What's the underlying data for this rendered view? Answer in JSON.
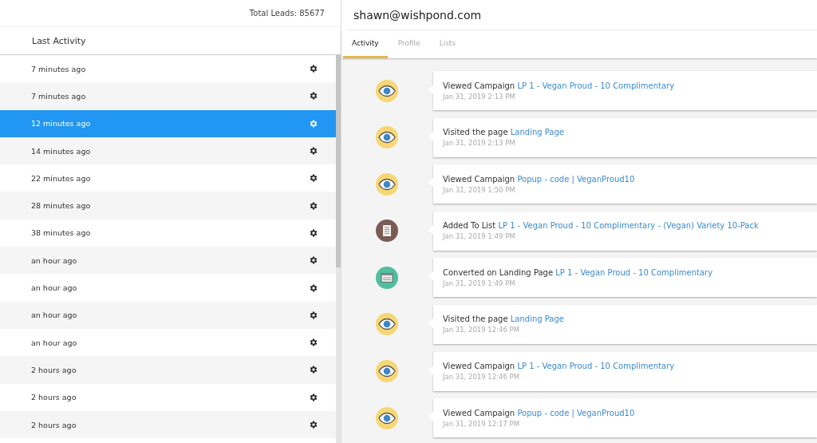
{
  "leads_panel": {
    "total": "Total Leads: 85677",
    "column_header": "Last Activity",
    "rows": [
      {
        "time": "7 minutes ago",
        "selected": false
      },
      {
        "time": "7 minutes ago",
        "selected": false
      },
      {
        "time": "12 minutes ago",
        "selected": true
      },
      {
        "time": "14 minutes ago",
        "selected": false
      },
      {
        "time": "22 minutes ago",
        "selected": false
      },
      {
        "time": "28 minutes ago",
        "selected": false
      },
      {
        "time": "38 minutes ago",
        "selected": false
      },
      {
        "time": "an hour ago",
        "selected": false
      },
      {
        "time": "an hour ago",
        "selected": false
      },
      {
        "time": "an hour ago",
        "selected": false
      },
      {
        "time": "an hour ago",
        "selected": false
      },
      {
        "time": "2 hours ago",
        "selected": false
      },
      {
        "time": "2 hours ago",
        "selected": false
      },
      {
        "time": "2 hours ago",
        "selected": false
      }
    ]
  },
  "detail": {
    "email": "shawn@wishpond.com",
    "tabs": [
      {
        "label": "Activity",
        "selected": true
      },
      {
        "label": "Profile",
        "selected": false
      },
      {
        "label": "Lists",
        "selected": false
      }
    ],
    "activities": [
      {
        "kind": "view",
        "action": "Viewed Campaign",
        "link": "LP 1 - Vegan Proud - 10 Complimentary",
        "date": "Jan 31, 2019 2:13 PM"
      },
      {
        "kind": "view",
        "action": "Visited the page",
        "link": "Landing Page",
        "date": "Jan 31, 2019 2:13 PM"
      },
      {
        "kind": "view",
        "action": "Viewed Campaign",
        "link": "Popup - code | VeganProud10",
        "date": "Jan 31, 2019 1:50 PM"
      },
      {
        "kind": "list",
        "action": "Added To List",
        "link": "LP 1 - Vegan Proud - 10 Complimentary - (Vegan) Variety 10-Pack",
        "date": "Jan 31, 2019 1:49 PM"
      },
      {
        "kind": "convert",
        "action": "Converted on Landing Page",
        "link": "LP 1 - Vegan Proud - 10 Complimentary",
        "date": "Jan 31, 2019 1:49 PM"
      },
      {
        "kind": "view",
        "action": "Visited the page",
        "link": "Landing Page",
        "date": "Jan 31, 2019 12:46 PM"
      },
      {
        "kind": "view",
        "action": "Viewed Campaign",
        "link": "LP 1 - Vegan Proud - 10 Complimentary",
        "date": "Jan 31, 2019 12:46 PM"
      },
      {
        "kind": "view",
        "action": "Viewed Campaign",
        "link": "Popup - code | VeganProud10",
        "date": "Jan 31, 2019 12:17 PM"
      }
    ]
  }
}
